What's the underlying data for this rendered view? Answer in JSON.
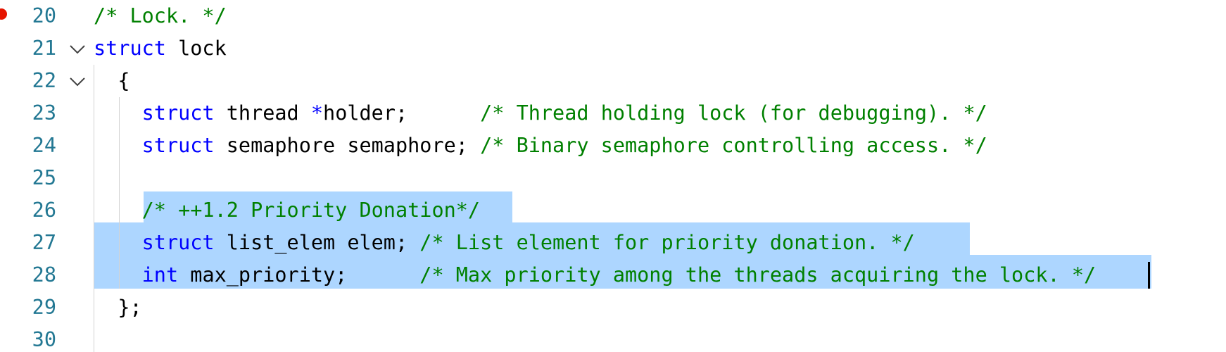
{
  "editor": {
    "breakpoint_line": "20",
    "lines": [
      {
        "number": "20",
        "tokens": [
          {
            "t": "/* Lock. */",
            "c": "cm"
          }
        ]
      },
      {
        "number": "21",
        "tokens": [
          {
            "t": "struct",
            "c": "kw"
          },
          {
            "t": " lock",
            "c": "tx"
          }
        ]
      },
      {
        "number": "22",
        "tokens": [
          {
            "t": "  {",
            "c": "tx"
          }
        ]
      },
      {
        "number": "23",
        "tokens": [
          {
            "t": "    ",
            "c": "tx"
          },
          {
            "t": "struct",
            "c": "kw"
          },
          {
            "t": " thread ",
            "c": "tx"
          },
          {
            "t": "*",
            "c": "op"
          },
          {
            "t": "holder;      ",
            "c": "tx"
          },
          {
            "t": "/* Thread holding lock (for debugging). */",
            "c": "cm"
          }
        ]
      },
      {
        "number": "24",
        "tokens": [
          {
            "t": "    ",
            "c": "tx"
          },
          {
            "t": "struct",
            "c": "kw"
          },
          {
            "t": " semaphore semaphore; ",
            "c": "tx"
          },
          {
            "t": "/* Binary semaphore controlling access. */",
            "c": "cm"
          }
        ]
      },
      {
        "number": "25",
        "tokens": []
      },
      {
        "number": "26",
        "tokens": [
          {
            "t": "    ",
            "c": "tx"
          },
          {
            "t": "/* ++1.2 Priority Donation*/",
            "c": "cm"
          }
        ]
      },
      {
        "number": "27",
        "tokens": [
          {
            "t": "    ",
            "c": "tx"
          },
          {
            "t": "struct",
            "c": "kw"
          },
          {
            "t": " list_elem elem; ",
            "c": "tx"
          },
          {
            "t": "/* List element for priority donation. */",
            "c": "cm"
          }
        ]
      },
      {
        "number": "28",
        "tokens": [
          {
            "t": "    ",
            "c": "tx"
          },
          {
            "t": "int",
            "c": "kw"
          },
          {
            "t": " max_priority;      ",
            "c": "tx"
          },
          {
            "t": "/* Max priority among the threads acquiring the lock. */",
            "c": "cm"
          }
        ]
      },
      {
        "number": "29",
        "tokens": [
          {
            "t": "  };",
            "c": "tx"
          }
        ]
      },
      {
        "number": "30",
        "tokens": []
      }
    ]
  },
  "colors": {
    "keyword": "#0000ff",
    "comment": "#008000",
    "text": "#000000",
    "line_number": "#237893",
    "selection": "#add6ff",
    "breakpoint": "#e51400"
  }
}
